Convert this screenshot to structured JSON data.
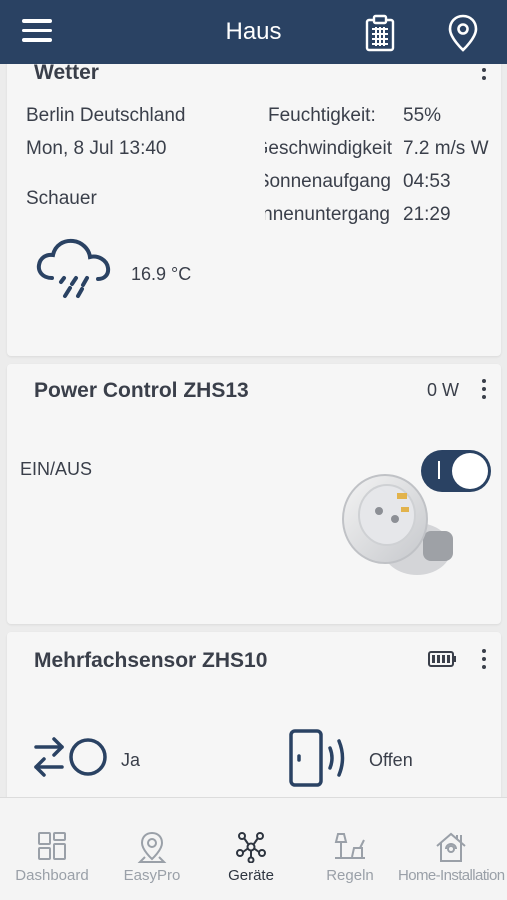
{
  "header": {
    "title": "Haus",
    "menu_icon": "hamburger-menu-icon",
    "clipboard_icon": "clipboard-icon",
    "location_icon": "location-pin-icon"
  },
  "weather_card": {
    "title": "Wetter",
    "location": "Berlin Deutschland",
    "datetime": "Mon, 8 Jul 13:40",
    "condition": "Schauer",
    "temperature": "16.9 °C",
    "icon": "rain-cloud-icon",
    "details": [
      {
        "label": "Feuchtigkeit:",
        "value": "55%"
      },
      {
        "label": "Geschwindigkeit:",
        "value": "7.2 m/s W"
      },
      {
        "label": "Sonnenaufgang:",
        "value": "04:53"
      },
      {
        "label": "Sonnenuntergang:",
        "value": "21:29"
      }
    ]
  },
  "power_card": {
    "title": "Power Control ZHS13",
    "power": "0 W",
    "switch_label": "EIN/AUS",
    "switch_on": true
  },
  "sensor_card": {
    "title": "Mehrfachsensor ZHS10",
    "battery_icon": "battery-full-icon",
    "motion_value": "Ja",
    "motion_icon": "motion-arrows-icon",
    "door_value": "Offen",
    "door_icon": "door-open-icon"
  },
  "bottom_nav": {
    "items": [
      {
        "label": "Dashboard",
        "icon": "dashboard-grid-icon",
        "active": false
      },
      {
        "label": "EasyPro",
        "icon": "map-pin-icon",
        "active": false
      },
      {
        "label": "Geräte",
        "icon": "devices-network-icon",
        "active": true
      },
      {
        "label": "Regeln",
        "icon": "rules-icon",
        "active": false
      },
      {
        "label": "Home-Installation",
        "icon": "home-installation-icon",
        "active": false
      }
    ]
  },
  "colors": {
    "header_bg": "#2a4263",
    "card_bg": "#f6f6f6",
    "page_bg": "#ececec",
    "text": "#3a3f4a",
    "nav_inactive": "#9aa0a8"
  }
}
